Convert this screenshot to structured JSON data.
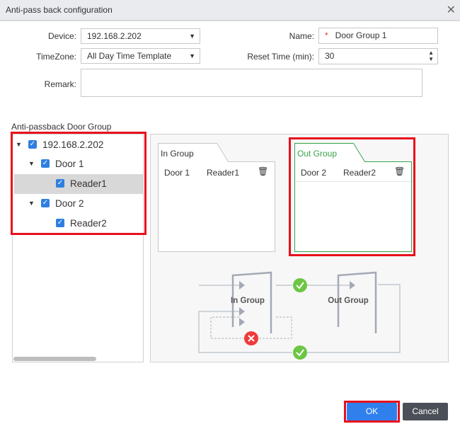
{
  "dialog": {
    "title": "Anti-pass back configuration"
  },
  "form": {
    "device_label": "Device:",
    "device_value": "192.168.2.202",
    "timezone_label": "TimeZone:",
    "timezone_value": "All Day Time Template",
    "name_label": "Name:",
    "name_required": "*",
    "name_value": "Door Group 1",
    "reset_label": "Reset Time (min):",
    "reset_value": "30",
    "remark_label": "Remark:",
    "remark_value": ""
  },
  "door_group": {
    "title": "Anti-passback Door Group",
    "tree": [
      {
        "label": "192.168.2.202"
      },
      {
        "label": "Door 1"
      },
      {
        "label": "Reader1"
      },
      {
        "label": "Door 2"
      },
      {
        "label": "Reader2"
      }
    ]
  },
  "in_group": {
    "title": "In Group",
    "rows": [
      {
        "door": "Door 1",
        "reader": "Reader1"
      }
    ]
  },
  "out_group": {
    "title": "Out Group",
    "rows": [
      {
        "door": "Door 2",
        "reader": "Reader2"
      }
    ]
  },
  "diagram": {
    "in_label": "In Group",
    "out_label": "Out Group"
  },
  "buttons": {
    "ok": "OK",
    "cancel": "Cancel"
  },
  "colors": {
    "accent": "#2f80ed",
    "highlight": "#e8101c",
    "green": "#6cc644",
    "red": "#ef3b3b"
  }
}
